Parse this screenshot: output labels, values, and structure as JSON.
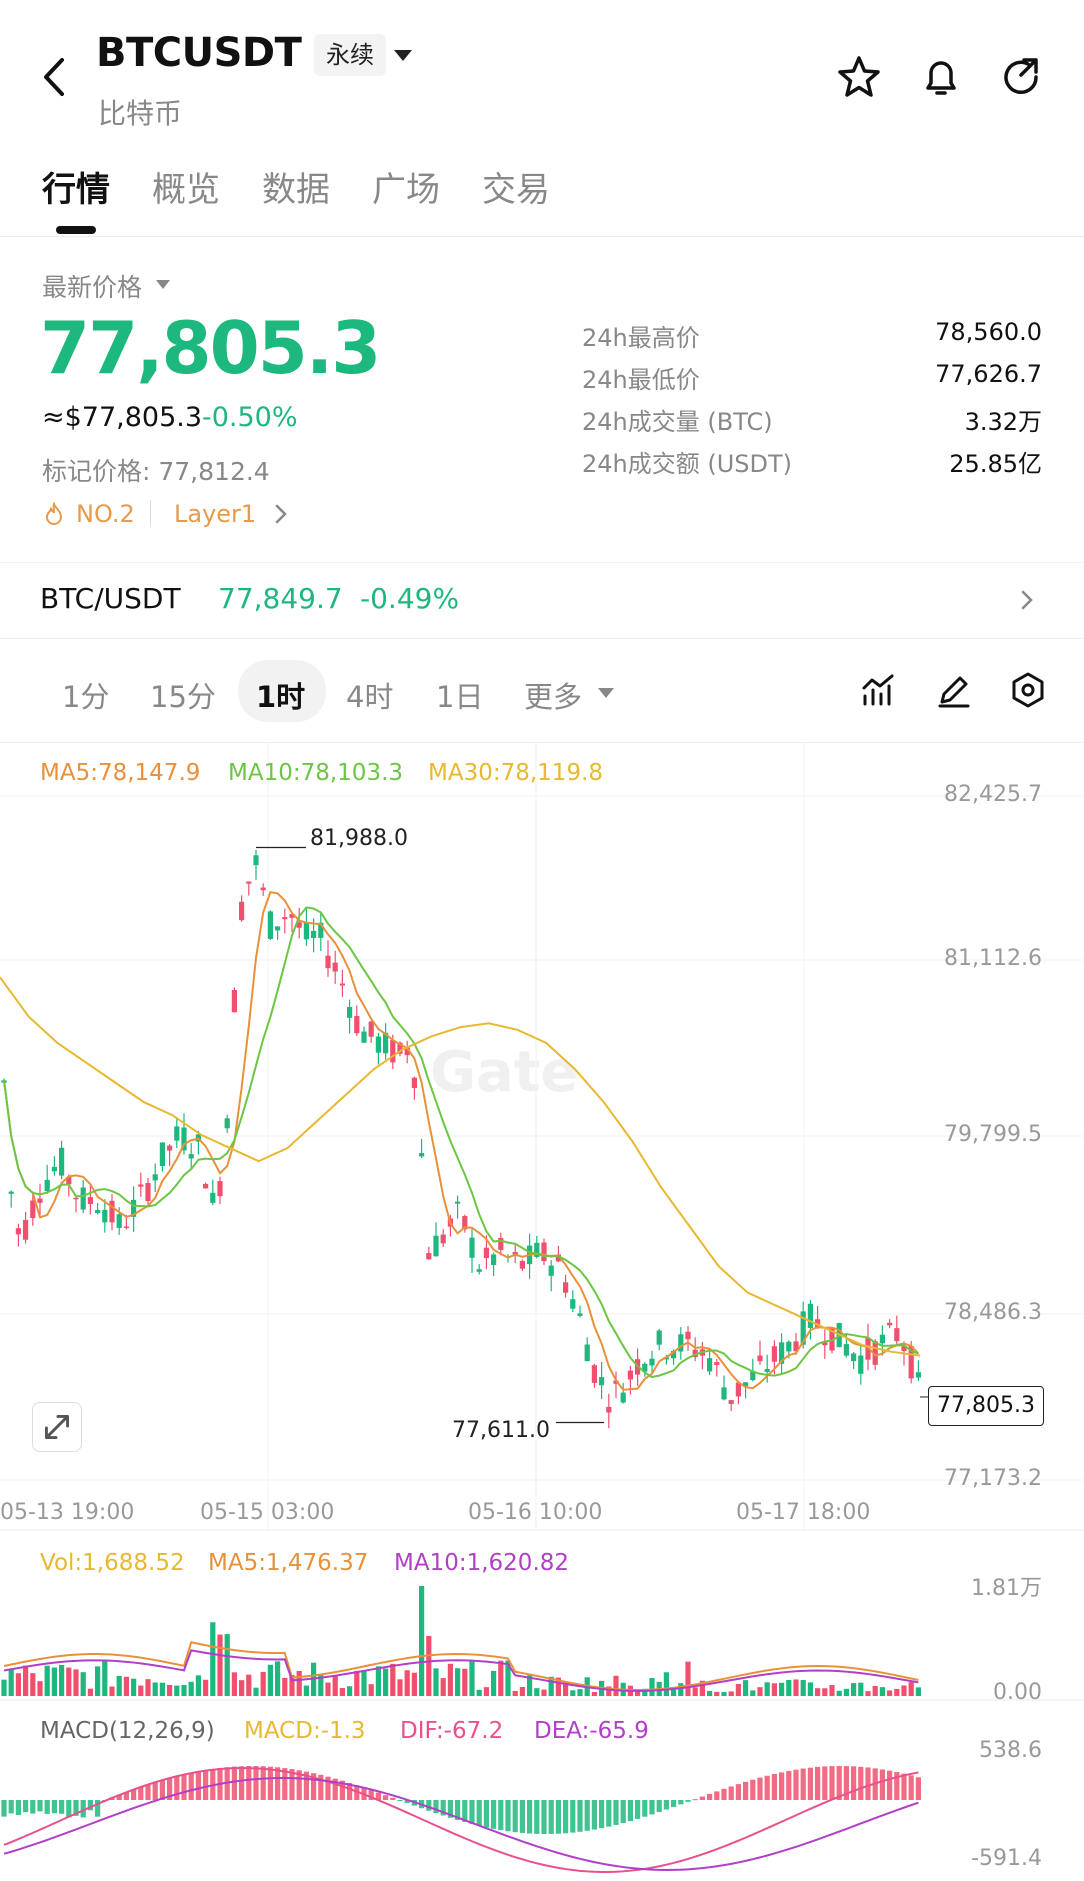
{
  "header": {
    "symbol": "BTCUSDT",
    "name": "比特币",
    "contract_type": "永续"
  },
  "tabs": [
    {
      "label": "行情",
      "active": true
    },
    {
      "label": "概览",
      "active": false
    },
    {
      "label": "数据",
      "active": false
    },
    {
      "label": "广场",
      "active": false
    },
    {
      "label": "交易",
      "active": false
    }
  ],
  "price": {
    "label": "最新价格",
    "last": "77,805.3",
    "usd": "≈$77,805.3",
    "change": "-0.50%",
    "mark": "标记价格: 77,812.4",
    "rank": "NO.2",
    "category": "Layer1"
  },
  "stats": [
    {
      "label": "24h最高价",
      "value": "78,560.0"
    },
    {
      "label": "24h最低价",
      "value": "77,626.7"
    },
    {
      "label": "24h成交量 (BTC)",
      "value": "3.32万"
    },
    {
      "label": "24h成交额 (USDT)",
      "value": "25.85亿"
    }
  ],
  "spot": {
    "pair": "BTC/USDT",
    "price": "77,849.7",
    "change": "-0.49%"
  },
  "intervals": [
    {
      "label": "1分",
      "active": false
    },
    {
      "label": "15分",
      "active": false
    },
    {
      "label": "1时",
      "active": true
    },
    {
      "label": "4时",
      "active": false
    },
    {
      "label": "1日",
      "active": false
    },
    {
      "label": "更多",
      "active": false
    }
  ],
  "indicators": {
    "ma5": "MA5:78,147.9",
    "ma10": "MA10:78,103.3",
    "ma30": "MA30:78,119.8",
    "vol": "Vol:1,688.52",
    "vol_ma5": "MA5:1,476.37",
    "vol_ma10": "MA10:1,620.82",
    "macd_title": "MACD(12,26,9)",
    "macd": "MACD:-1.3",
    "dif": "DIF:-67.2",
    "dea": "DEA:-65.9"
  },
  "colors": {
    "up": "#1cb87e",
    "down": "#f0506e",
    "ma5": "#e8913a",
    "ma10": "#6cc644",
    "ma30": "#e8b830",
    "vol_ma10": "#b13fc7"
  },
  "chart_data": {
    "type": "candlestick",
    "y_ticks": [
      "82,425.7",
      "81,112.6",
      "79,799.5",
      "78,486.3",
      "77,173.2"
    ],
    "ylim": [
      77173.2,
      82425.7
    ],
    "x_ticks": [
      "05-13 19:00",
      "05-15 03:00",
      "05-16 10:00",
      "05-17 18:00"
    ],
    "high_label": "81,988.0",
    "low_label": "77,611.0",
    "current_price_tag": "77,805.3",
    "high": 81988.0,
    "low": 77611.0,
    "last": 77805.3,
    "ma30_path": [
      81000,
      80700,
      80500,
      80350,
      80200,
      80050,
      79950,
      79800,
      79700,
      79600,
      79700,
      79900,
      80100,
      80300,
      80450,
      80550,
      80620,
      80650,
      80600,
      80500,
      80300,
      80050,
      79750,
      79400,
      79100,
      78800,
      78600,
      78500,
      78400,
      78300,
      78200,
      78150,
      78120
    ],
    "vol_axis": [
      "1.81万",
      "0.00"
    ],
    "macd_axis": [
      "538.6",
      "-591.4"
    ]
  }
}
